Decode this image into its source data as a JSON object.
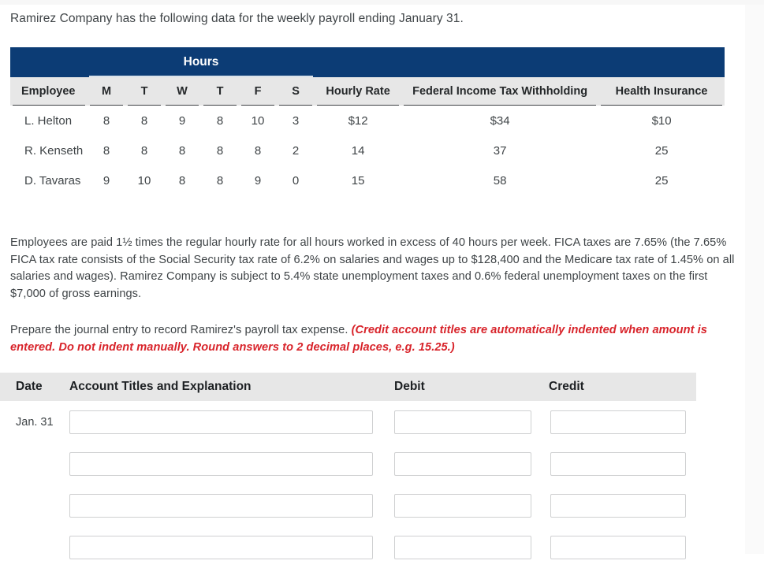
{
  "intro": "Ramirez Company has the following data for the weekly payroll ending January 31.",
  "payroll_table": {
    "group_header": "Hours",
    "columns": {
      "employee": "Employee",
      "days": [
        "M",
        "T",
        "W",
        "T",
        "F",
        "S"
      ],
      "hourly_rate": "Hourly Rate",
      "federal_income_tax_withholding": "Federal Income Tax Withholding",
      "health_insurance": "Health Insurance"
    },
    "rows": [
      {
        "employee": "L. Helton",
        "m": "8",
        "t1": "8",
        "w": "9",
        "t2": "8",
        "f": "10",
        "s": "3",
        "hourly_rate": "$12",
        "federal_income_tax_withholding": "$34",
        "health_insurance": "$10"
      },
      {
        "employee": "R. Kenseth",
        "m": "8",
        "t1": "8",
        "w": "8",
        "t2": "8",
        "f": "8",
        "s": "2",
        "hourly_rate": "14",
        "federal_income_tax_withholding": "37",
        "health_insurance": "25"
      },
      {
        "employee": "D. Tavaras",
        "m": "9",
        "t1": "10",
        "w": "8",
        "t2": "8",
        "f": "9",
        "s": "0",
        "hourly_rate": "15",
        "federal_income_tax_withholding": "58",
        "health_insurance": "25"
      }
    ]
  },
  "tax_paragraph": "Employees are paid 1½ times the regular hourly rate for all hours worked in excess of 40 hours per week. FICA taxes are 7.65% (the 7.65% FICA tax rate consists of the Social Security tax rate of 6.2% on salaries and wages up to $128,400 and the Medicare tax rate of 1.45% on all salaries and wages). Ramirez Company is subject to 5.4% state unemployment taxes and 0.6% federal unemployment taxes on the first $7,000 of gross earnings.",
  "prepare": {
    "lead": "Prepare the journal entry to record Ramirez's payroll tax expense. ",
    "emphasis": "(Credit account titles are automatically indented when amount is entered. Do not indent manually. Round answers to 2 decimal places, e.g. 15.25.)"
  },
  "journal_table": {
    "headers": {
      "date": "Date",
      "account": "Account Titles and Explanation",
      "debit": "Debit",
      "credit": "Credit"
    },
    "rows": [
      {
        "date": "Jan. 31",
        "account": "",
        "debit": "",
        "credit": ""
      },
      {
        "date": "",
        "account": "",
        "debit": "",
        "credit": ""
      },
      {
        "date": "",
        "account": "",
        "debit": "",
        "credit": ""
      },
      {
        "date": "",
        "account": "",
        "debit": "",
        "credit": ""
      }
    ]
  },
  "colors": {
    "header_band": "#0c3c75",
    "table_head_bg": "#e7e7e7",
    "emphasis_red": "#d8232a",
    "body_text": "#3f4447"
  }
}
